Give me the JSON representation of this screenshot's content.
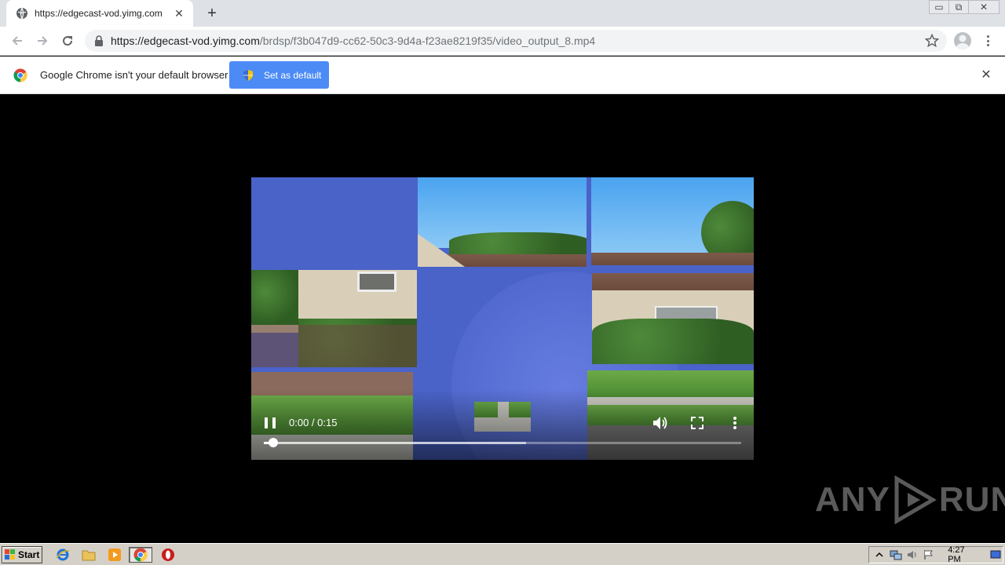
{
  "tab": {
    "title": "https://edgecast-vod.yimg.com",
    "close": "✕"
  },
  "newtab": "+",
  "window_controls": {
    "minimize": "▭",
    "restore": "⧉",
    "close": "✕"
  },
  "omnibox": {
    "host": "https://edgecast-vod.yimg.com",
    "path": "/brdsp/f3b047d9-cc62-50c3-9d4a-f23ae8219f35/video_output_8.mp4"
  },
  "infobar": {
    "message": "Google Chrome isn't your default browser",
    "button": "Set as default",
    "close": "✕"
  },
  "video": {
    "time": "0:00 / 0:15",
    "played_fraction": 0.02,
    "buffered_fraction": 0.55
  },
  "watermark": {
    "left": "ANY",
    "right": "RUN"
  },
  "taskbar": {
    "start": "Start",
    "clock": "4:27 PM"
  },
  "colors": {
    "accent": "#4c8bf5",
    "video_bg": "#4a63c9"
  }
}
